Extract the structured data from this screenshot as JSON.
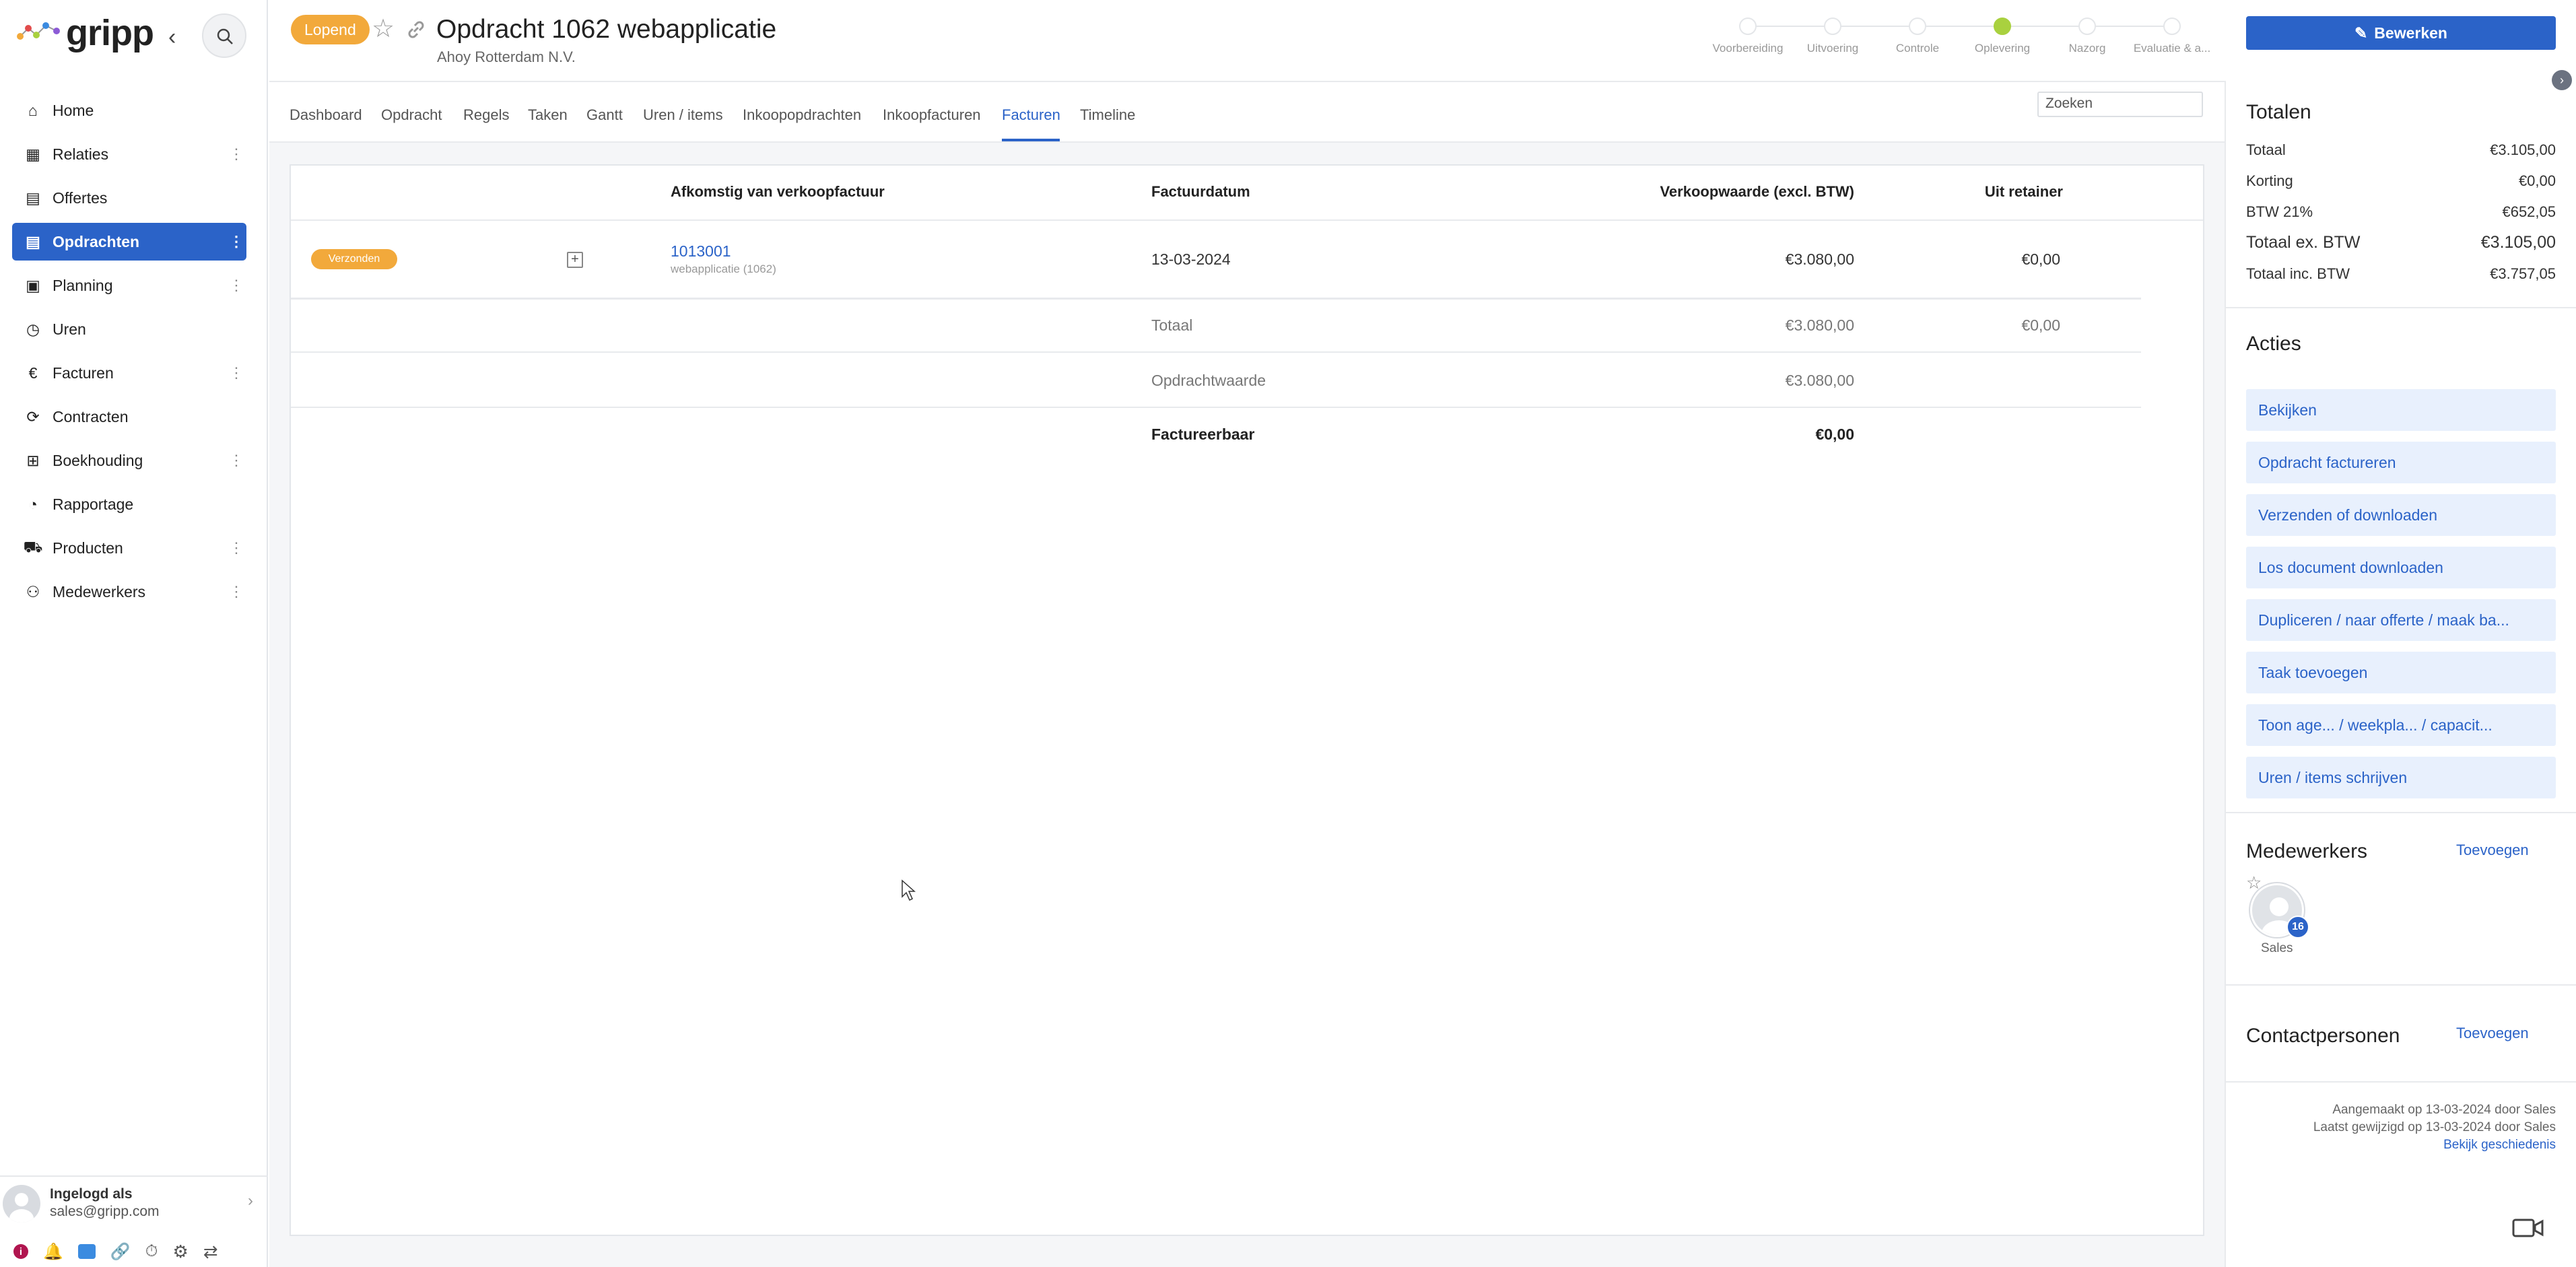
{
  "app": {
    "logo": "gripp"
  },
  "sidebar": {
    "items": [
      {
        "label": "Home",
        "icon": "home-icon",
        "kebab": false,
        "active": false
      },
      {
        "label": "Relaties",
        "icon": "building-icon",
        "kebab": true,
        "active": false
      },
      {
        "label": "Offertes",
        "icon": "document-icon",
        "kebab": false,
        "active": false
      },
      {
        "label": "Opdrachten",
        "icon": "document-icon",
        "kebab": true,
        "active": true
      },
      {
        "label": "Planning",
        "icon": "calendar-icon",
        "kebab": true,
        "active": false
      },
      {
        "label": "Uren",
        "icon": "stopwatch-icon",
        "kebab": false,
        "active": false
      },
      {
        "label": "Facturen",
        "icon": "euro-icon",
        "kebab": true,
        "active": false
      },
      {
        "label": "Contracten",
        "icon": "refresh-icon",
        "kebab": false,
        "active": false
      },
      {
        "label": "Boekhouding",
        "icon": "grid-icon",
        "kebab": true,
        "active": false
      },
      {
        "label": "Rapportage",
        "icon": "pie-chart-icon",
        "kebab": false,
        "active": false
      },
      {
        "label": "Producten",
        "icon": "cart-icon",
        "kebab": true,
        "active": false
      },
      {
        "label": "Medewerkers",
        "icon": "people-icon",
        "kebab": true,
        "active": false
      }
    ],
    "user": {
      "line1": "Ingelogd als",
      "line2": "sales@gripp.com"
    }
  },
  "header": {
    "status": "Lopend",
    "title": "Opdracht 1062 webapplicatie",
    "subtitle": "Ahoy Rotterdam N.V.",
    "phases": [
      {
        "label": "Voorbereiding",
        "active": false
      },
      {
        "label": "Uitvoering",
        "active": false
      },
      {
        "label": "Controle",
        "active": false
      },
      {
        "label": "Oplevering",
        "active": true
      },
      {
        "label": "Nazorg",
        "active": false
      },
      {
        "label": "Evaluatie & a...",
        "active": false
      }
    ],
    "edit_label": "Bewerken"
  },
  "tabs": [
    {
      "label": "Dashboard"
    },
    {
      "label": "Opdracht"
    },
    {
      "label": "Regels"
    },
    {
      "label": "Taken"
    },
    {
      "label": "Gantt"
    },
    {
      "label": "Uren / items"
    },
    {
      "label": "Inkoopopdrachten"
    },
    {
      "label": "Inkoopfacturen"
    },
    {
      "label": "Facturen"
    },
    {
      "label": "Timeline"
    }
  ],
  "search": {
    "placeholder": "Zoeken"
  },
  "table": {
    "headers": {
      "source": "Afkomstig van verkoopfactuur",
      "date": "Factuurdatum",
      "value": "Verkoopwaarde (excl. BTW)",
      "retainer": "Uit retainer"
    },
    "rows": [
      {
        "status": "Verzonden",
        "invoice": "1013001",
        "invoice_sub": "webapplicatie (1062)",
        "date": "13-03-2024",
        "value": "€3.080,00",
        "retainer": "€0,00"
      }
    ],
    "summary": {
      "total_label": "Totaal",
      "total_value": "€3.080,00",
      "total_retainer": "€0,00",
      "contract_label": "Opdrachtwaarde",
      "contract_value": "€3.080,00",
      "billable_label": "Factureerbaar",
      "billable_value": "€0,00"
    }
  },
  "right_panel": {
    "totals_title": "Totalen",
    "totals": [
      {
        "label": "Totaal",
        "value": "€3.105,00"
      },
      {
        "label": "Korting",
        "value": "€0,00"
      },
      {
        "label": "BTW 21%",
        "value": "€652,05"
      },
      {
        "label": "Totaal ex. BTW",
        "value": "€3.105,00"
      },
      {
        "label": "Totaal inc. BTW",
        "value": "€3.757,05"
      }
    ],
    "actions_title": "Acties",
    "actions": [
      "Bekijken",
      "Opdracht factureren",
      "Verzenden of downloaden",
      "Los document downloaden",
      "Dupliceren / naar offerte / maak ba...",
      "Taak toevoegen",
      "Toon age...   / weekpla...   / capacit...",
      "Uren / items schrijven"
    ],
    "employees_title": "Medewerkers",
    "employees_add": "Toevoegen",
    "employee": {
      "name": "Sales",
      "badge": "16"
    },
    "contacts_title": "Contactpersonen",
    "contacts_add": "Toevoegen",
    "meta": {
      "created": "Aangemaakt op 13-03-2024 door Sales",
      "modified": "Laatst gewijzigd op 13-03-2024 door Sales",
      "history": "Bekijk geschiedenis"
    }
  }
}
